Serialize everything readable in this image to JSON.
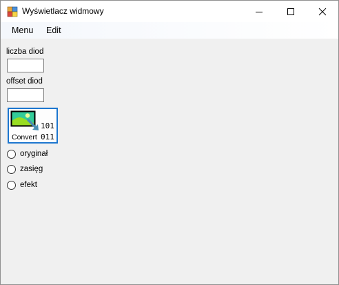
{
  "window": {
    "title": "Wyświetlacz widmowy",
    "app_icon": "windows-forms-app-icon",
    "controls": {
      "minimize_icon": "minimize-icon",
      "maximize_icon": "maximize-icon",
      "close_icon": "close-icon"
    }
  },
  "menu": {
    "items": [
      {
        "label": "Menu"
      },
      {
        "label": "Edit"
      }
    ]
  },
  "form": {
    "led_count_label": "liczba diod",
    "led_count_value": "",
    "led_offset_label": "offset diod",
    "led_offset_value": "",
    "convert_button": {
      "caption": "Convert",
      "icon": "image-to-binary-icon",
      "bits_top": "101",
      "bits_bottom": "011"
    },
    "radio_options": [
      {
        "label": "oryginał",
        "checked": false
      },
      {
        "label": "zasięg",
        "checked": false
      },
      {
        "label": "efekt",
        "checked": false
      }
    ]
  },
  "colors": {
    "window_bg": "#f0f0f0",
    "titlebar_bg": "#ffffff",
    "focus_border": "#1c76cf",
    "icon_sky": "#33cc99",
    "icon_hill": "#99dd22",
    "icon_arrow": "#4a8fb5"
  }
}
